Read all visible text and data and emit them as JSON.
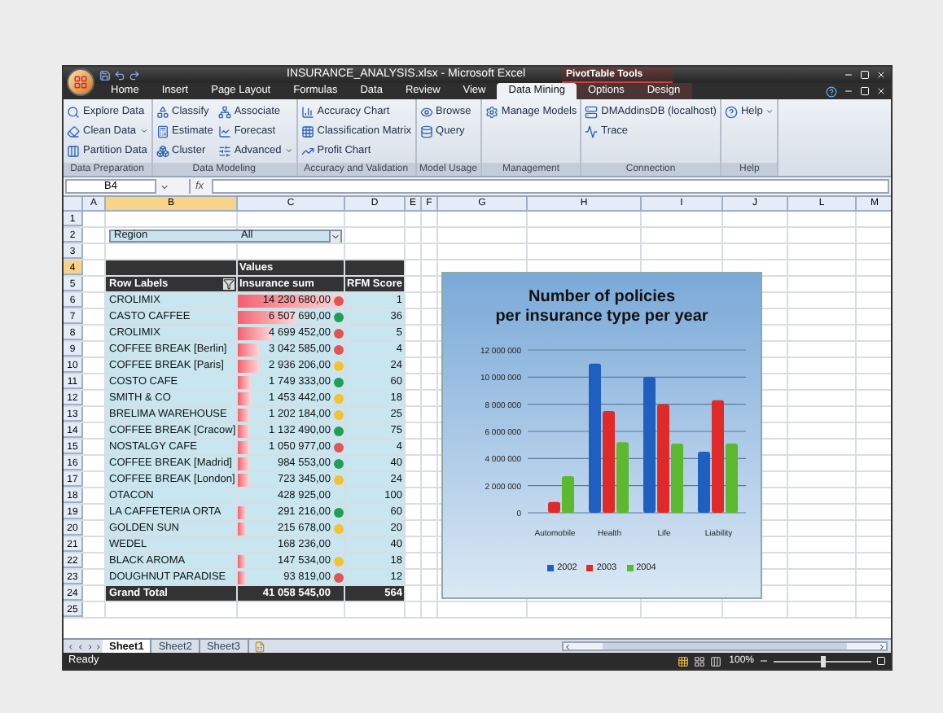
{
  "window": {
    "title": "INSURANCE_ANALYSIS.xlsx - Microsoft Excel",
    "contextual_group": "PivotTable Tools"
  },
  "tabs": [
    {
      "label": "Home",
      "selected": false,
      "contextual": false
    },
    {
      "label": "Insert",
      "selected": false,
      "contextual": false
    },
    {
      "label": "Page Layout",
      "selected": false,
      "contextual": false
    },
    {
      "label": "Formulas",
      "selected": false,
      "contextual": false
    },
    {
      "label": "Data",
      "selected": false,
      "contextual": false
    },
    {
      "label": "Review",
      "selected": false,
      "contextual": false
    },
    {
      "label": "View",
      "selected": false,
      "contextual": false
    },
    {
      "label": "Data Mining",
      "selected": true,
      "contextual": false
    },
    {
      "label": "Options",
      "selected": false,
      "contextual": true
    },
    {
      "label": "Design",
      "selected": false,
      "contextual": true
    }
  ],
  "ribbon": {
    "groups": [
      {
        "label": "Data Preparation",
        "columns": [
          [
            {
              "label": "Explore Data",
              "dropdown": false
            },
            {
              "label": "Clean Data",
              "dropdown": true
            },
            {
              "label": "Partition Data",
              "dropdown": false
            }
          ]
        ]
      },
      {
        "label": "Data Modeling",
        "columns": [
          [
            {
              "label": "Classify",
              "dropdown": false
            },
            {
              "label": "Estimate",
              "dropdown": false
            },
            {
              "label": "Cluster",
              "dropdown": false
            }
          ],
          [
            {
              "label": "Associate",
              "dropdown": false
            },
            {
              "label": "Forecast",
              "dropdown": false
            },
            {
              "label": "Advanced",
              "dropdown": true
            }
          ]
        ]
      },
      {
        "label": "Accuracy and Validation",
        "columns": [
          [
            {
              "label": "Accuracy Chart",
              "dropdown": false
            },
            {
              "label": "Classification Matrix",
              "dropdown": false
            },
            {
              "label": "Profit Chart",
              "dropdown": false
            }
          ]
        ]
      },
      {
        "label": "Model Usage",
        "columns": [
          [
            {
              "label": "Browse",
              "dropdown": false
            },
            {
              "label": "Query",
              "dropdown": false
            }
          ]
        ]
      },
      {
        "label": "Management",
        "columns": [
          [
            {
              "label": "Manage Models",
              "dropdown": false
            }
          ]
        ]
      },
      {
        "label": "Connection",
        "columns": [
          [
            {
              "label": "DMAddinsDB (localhost)",
              "dropdown": false
            },
            {
              "label": "Trace",
              "dropdown": false
            }
          ]
        ]
      },
      {
        "label": "Help",
        "columns": [
          [
            {
              "label": "Help",
              "dropdown": true
            }
          ]
        ]
      }
    ]
  },
  "formula_bar": {
    "name_box": "B4",
    "function_label": "fx"
  },
  "columns": [
    {
      "label": "A",
      "selected": false
    },
    {
      "label": "B",
      "selected": true
    },
    {
      "label": "C",
      "selected": false
    },
    {
      "label": "D",
      "selected": false
    },
    {
      "label": "E",
      "selected": false
    },
    {
      "label": "F",
      "selected": false
    },
    {
      "label": "G",
      "selected": false
    },
    {
      "label": "H",
      "selected": false
    },
    {
      "label": "I",
      "selected": false
    },
    {
      "label": "J",
      "selected": false
    },
    {
      "label": "L",
      "selected": false
    },
    {
      "label": "M",
      "selected": false
    }
  ],
  "row_headers": [
    {
      "label": "1",
      "selected": false
    },
    {
      "label": "2",
      "selected": false
    },
    {
      "label": "3",
      "selected": false
    },
    {
      "label": "4",
      "selected": true
    },
    {
      "label": "5",
      "selected": false
    },
    {
      "label": "6",
      "selected": false
    },
    {
      "label": "7",
      "selected": false
    },
    {
      "label": "8",
      "selected": false
    },
    {
      "label": "9",
      "selected": false
    },
    {
      "label": "10",
      "selected": false
    },
    {
      "label": "11",
      "selected": false
    },
    {
      "label": "12",
      "selected": false
    },
    {
      "label": "13",
      "selected": false
    },
    {
      "label": "14",
      "selected": false
    },
    {
      "label": "15",
      "selected": false
    },
    {
      "label": "16",
      "selected": false
    },
    {
      "label": "17",
      "selected": false
    },
    {
      "label": "18",
      "selected": false
    },
    {
      "label": "19",
      "selected": false
    },
    {
      "label": "20",
      "selected": false
    },
    {
      "label": "21",
      "selected": false
    },
    {
      "label": "22",
      "selected": false
    },
    {
      "label": "23",
      "selected": false
    },
    {
      "label": "24",
      "selected": false
    },
    {
      "label": "25",
      "selected": false
    }
  ],
  "pivot": {
    "filter": {
      "label": "Region",
      "value": "All"
    },
    "header": "Values",
    "columns": [
      "Row Labels",
      "Insurance sum",
      "RFM Score"
    ],
    "rows": [
      {
        "label": "CROLIMIX",
        "sum": "14 230 680,00",
        "score": "1",
        "level": 1,
        "color": "#e05555"
      },
      {
        "label": "CASTO CAFFEE",
        "sum": "6 507 690,00",
        "score": "36",
        "level": 0.55,
        "color": "#1f9e55"
      },
      {
        "label": "CROLIMIX",
        "sum": "4 699 452,00",
        "score": "5",
        "level": 0.32,
        "color": "#e05555"
      },
      {
        "label": "COFFEE BREAK [Berlin]",
        "sum": "3 042 585,00",
        "score": "4",
        "level": 0.2,
        "color": "#e05555"
      },
      {
        "label": "COFFEE BREAK [Paris]",
        "sum": "2 936 206,00",
        "score": "24",
        "level": 0.2,
        "color": "#f2c232"
      },
      {
        "label": "COSTO CAFE",
        "sum": "1 749 333,00",
        "score": "60",
        "level": 0.13,
        "color": "#1f9e55"
      },
      {
        "label": "SMITH & CO",
        "sum": "1 453 442,00",
        "score": "18",
        "level": 0.13,
        "color": "#f2c232"
      },
      {
        "label": "BRELIMA WAREHOUSE",
        "sum": "1 202 184,00",
        "score": "25",
        "level": 0.11,
        "color": "#f2c232"
      },
      {
        "label": "COFFEE BREAK [Cracow]",
        "sum": "1 132 490,00",
        "score": "75",
        "level": 0.11,
        "color": "#1f9e55"
      },
      {
        "label": "NOSTALGY CAFE",
        "sum": "1 050 977,00",
        "score": "4",
        "level": 0.11,
        "color": "#e05555"
      },
      {
        "label": "COFFEE BREAK [Madrid]",
        "sum": "984 553,00",
        "score": "40",
        "level": 0.11,
        "color": "#1f9e55"
      },
      {
        "label": "COFFEE BREAK [London]",
        "sum": "723 345,00",
        "score": "24",
        "level": 0.11,
        "color": "#f2c232"
      },
      {
        "label": "OTACON",
        "sum": "428 925,00",
        "score": "100"
      },
      {
        "label": "LA CAFFETERIA ORTA",
        "sum": "291 216,00",
        "score": "60",
        "level": 0.07,
        "color": "#1f9e55"
      },
      {
        "label": "GOLDEN SUN",
        "sum": "215 678,00",
        "score": "20",
        "level": 0.07,
        "color": "#f2c232"
      },
      {
        "label": "WEDEL",
        "sum": "168 236,00",
        "score": "40"
      },
      {
        "label": "BLACK AROMA",
        "sum": "147 534,00",
        "score": "18",
        "level": 0.07,
        "color": "#f2c232"
      },
      {
        "label": "DOUGHNUT PARADISE",
        "sum": "93 819,00",
        "score": "12",
        "level": 0.07,
        "color": "#e05555"
      }
    ],
    "total": {
      "label": "Grand Total",
      "sum": "41 058 545,00",
      "score": "564"
    }
  },
  "chart": {
    "chart_data": {
      "type": "bar",
      "title": "Number of policies\nper insurance type per year",
      "grid": true,
      "legend": true,
      "categories": [
        "Automobile",
        "Health",
        "Life",
        "Liability"
      ],
      "series": [
        {
          "name": "2002",
          "color": "#1f5fbf",
          "values": [
            null,
            11000000,
            10000000,
            4500000
          ]
        },
        {
          "name": "2003",
          "color": "#e02a2a",
          "values": [
            800000,
            7500000,
            8000000,
            8300000
          ]
        },
        {
          "name": "2004",
          "color": "#5cb82e",
          "values": [
            2700000,
            5200000,
            5100000,
            5100000
          ]
        }
      ],
      "ylim": [
        0,
        12000000
      ],
      "yticks": [
        {
          "value": 0,
          "label": "0"
        },
        {
          "value": 2000000,
          "label": "2 000 000"
        },
        {
          "value": 4000000,
          "label": "4 000 000"
        },
        {
          "value": 6000000,
          "label": "6 000 000"
        },
        {
          "value": 8000000,
          "label": "8 000 000"
        },
        {
          "value": 10000000,
          "label": "10 000 000"
        },
        {
          "value": 12000000,
          "label": "12 000 000"
        }
      ]
    }
  },
  "sheet_tabs": [
    {
      "label": "Sheet1",
      "selected": true
    },
    {
      "label": "Sheet2",
      "selected": false
    },
    {
      "label": "Sheet3",
      "selected": false
    }
  ],
  "status_bar": {
    "text": "Ready",
    "zoom": "100%",
    "zoom_slider": {
      "level": 0.5
    }
  }
}
